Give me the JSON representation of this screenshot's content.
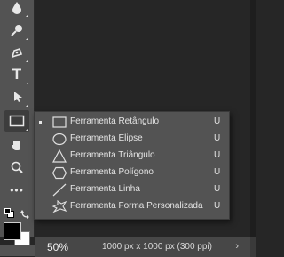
{
  "toolbar": {
    "tools": [
      {
        "name": "drop-icon"
      },
      {
        "name": "pen-icon"
      },
      {
        "name": "pen-nib-icon"
      },
      {
        "name": "type-icon",
        "glyph": "T"
      },
      {
        "name": "selection-arrow-icon"
      },
      {
        "name": "rectangle-icon"
      },
      {
        "name": "hand-icon"
      },
      {
        "name": "zoom-icon"
      },
      {
        "name": "more-icon",
        "glyph": "•••"
      }
    ]
  },
  "flyout": {
    "items": [
      {
        "label": "Ferramenta Retângulo",
        "shortcut": "U",
        "icon": "rectangle-icon",
        "selected": true
      },
      {
        "label": "Ferramenta Elipse",
        "shortcut": "U",
        "icon": "ellipse-icon",
        "selected": false
      },
      {
        "label": "Ferramenta Triângulo",
        "shortcut": "U",
        "icon": "triangle-icon",
        "selected": false
      },
      {
        "label": "Ferramenta Polígono",
        "shortcut": "U",
        "icon": "polygon-icon",
        "selected": false
      },
      {
        "label": "Ferramenta Linha",
        "shortcut": "U",
        "icon": "line-icon",
        "selected": false
      },
      {
        "label": "Ferramenta Forma Personalizada",
        "shortcut": "U",
        "icon": "custom-shape-icon",
        "selected": false
      }
    ]
  },
  "colors": {
    "foreground": "#000000",
    "background": "#ffffff"
  },
  "status": {
    "zoom": "50%",
    "doc_info": "1000 px x 1000 px (300 ppi)",
    "arrow": "›"
  }
}
